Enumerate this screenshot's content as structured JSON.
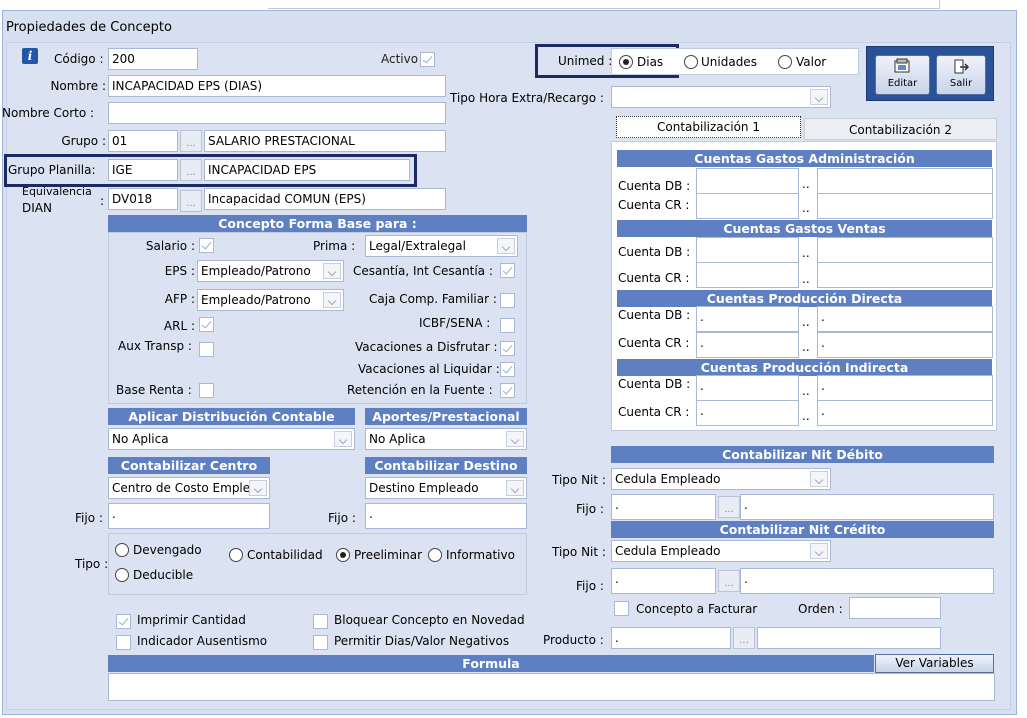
{
  "window_title": "Propiedades de Concepto",
  "codigo": {
    "label": "Código :",
    "value": "200"
  },
  "activo": {
    "label": "Activo :",
    "checked": true
  },
  "nombre": {
    "label": "Nombre :",
    "value": "INCAPACIDAD EPS (DIAS)"
  },
  "nombre_corto": {
    "label": "Nombre Corto :",
    "value": ""
  },
  "grupo": {
    "label": "Grupo :",
    "code": "01",
    "name": "SALARIO PRESTACIONAL"
  },
  "grupo_planilla": {
    "label": "Grupo Planilla:",
    "code": "IGE",
    "name": "INCAPACIDAD EPS"
  },
  "equivalencia": {
    "label_line1": "Equivalencia",
    "label_line2": "DIAN",
    "colon": ":",
    "code": "DV018",
    "name": "Incapacidad COMUN (EPS)"
  },
  "unimed": {
    "label": "Unimed :",
    "options": [
      "Dias",
      "Unidades",
      "Valor"
    ],
    "selected": "Dias"
  },
  "tipo_hora": {
    "label": "Tipo Hora Extra/Recargo :",
    "value": ""
  },
  "buttons": {
    "editar": "Editar",
    "salir": "Salir"
  },
  "concepto_base": {
    "title": "Concepto Forma Base para :",
    "salario": "Salario :",
    "prima": "Prima :",
    "prima_value": "Legal/Extralegal",
    "eps": "EPS :",
    "eps_value": "Empleado/Patrono",
    "cesantia": "Cesantía, Int Cesantía :",
    "afp": "AFP :",
    "afp_value": "Empleado/Patrono",
    "caja": "Caja Comp. Familiar :",
    "arl": "ARL :",
    "icbf": "ICBF/SENA :",
    "aux": "Aux Transp :",
    "vac_disfrutar": "Vacaciones a Disfrutar :",
    "vac_liquidar": "Vacaciones al Liquidar :",
    "base_renta": "Base Renta :",
    "retencion": "Retención en la Fuente :"
  },
  "aplicar_dist": {
    "title": "Aplicar Distribución Contable",
    "value": "No Aplica"
  },
  "aportes": {
    "title": "Aportes/Prestacional",
    "value": "No Aplica"
  },
  "contab_centro": {
    "title": "Contabilizar Centro",
    "value": "Centro de Costo Emple"
  },
  "contab_destino": {
    "title": "Contabilizar Destino",
    "value": "Destino Empleado"
  },
  "fijo_label": "Fijo :",
  "fijo_centro": ".",
  "fijo_destino": ".",
  "tipo": {
    "label": "Tipo :",
    "options": [
      "Devengado",
      "Contabilidad",
      "Preeliminar",
      "Informativo",
      "Deducible"
    ],
    "selected": "Preeliminar"
  },
  "checks": {
    "imprimir": "Imprimir Cantidad",
    "bloquear": "Bloquear Concepto en Novedad",
    "indicador": "Indicador Ausentismo",
    "permitir": "Permitir Dias/Valor Negativos"
  },
  "formula": {
    "title": "Formula",
    "ver_variables": "Ver Variables",
    "value": ""
  },
  "tabs": [
    "Contabilización 1",
    "Contabilización 2"
  ],
  "cuentas": [
    {
      "title": "Cuentas Gastos Administración",
      "db_value": "",
      "cr_value": "",
      "sep": ".."
    },
    {
      "title": "Cuentas Gastos Ventas",
      "db_value": "",
      "cr_value": "",
      "sep": ".."
    },
    {
      "title": "Cuentas Producción Directa",
      "db_value": ".",
      "cr_value": ".",
      "sep": ".."
    },
    {
      "title": "Cuentas Producción Indirecta",
      "db_value": ".",
      "cr_value": ".",
      "sep": ".."
    }
  ],
  "cuenta_db": "Cuenta DB :",
  "cuenta_cr": "Cuenta CR :",
  "nit_debito": {
    "title": "Contabilizar Nit Débito",
    "tipo_label": "Tipo Nit :",
    "tipo_value": "Cedula Empleado",
    "fijo_value": "."
  },
  "nit_credito": {
    "title": "Contabilizar Nit Crédito",
    "tipo_label": "Tipo Nit :",
    "tipo_value": "Cedula Empleado",
    "fijo_value": "."
  },
  "concepto_facturar": {
    "label": "Concepto a Facturar",
    "orden_label": "Orden :",
    "orden_value": ""
  },
  "producto": {
    "label": "Producto :",
    "value": ".",
    "name": ""
  },
  "colors": {
    "header_blue": "#5e7fc1",
    "highlight": "#1b2a63",
    "panel": "#dbe3f2"
  }
}
